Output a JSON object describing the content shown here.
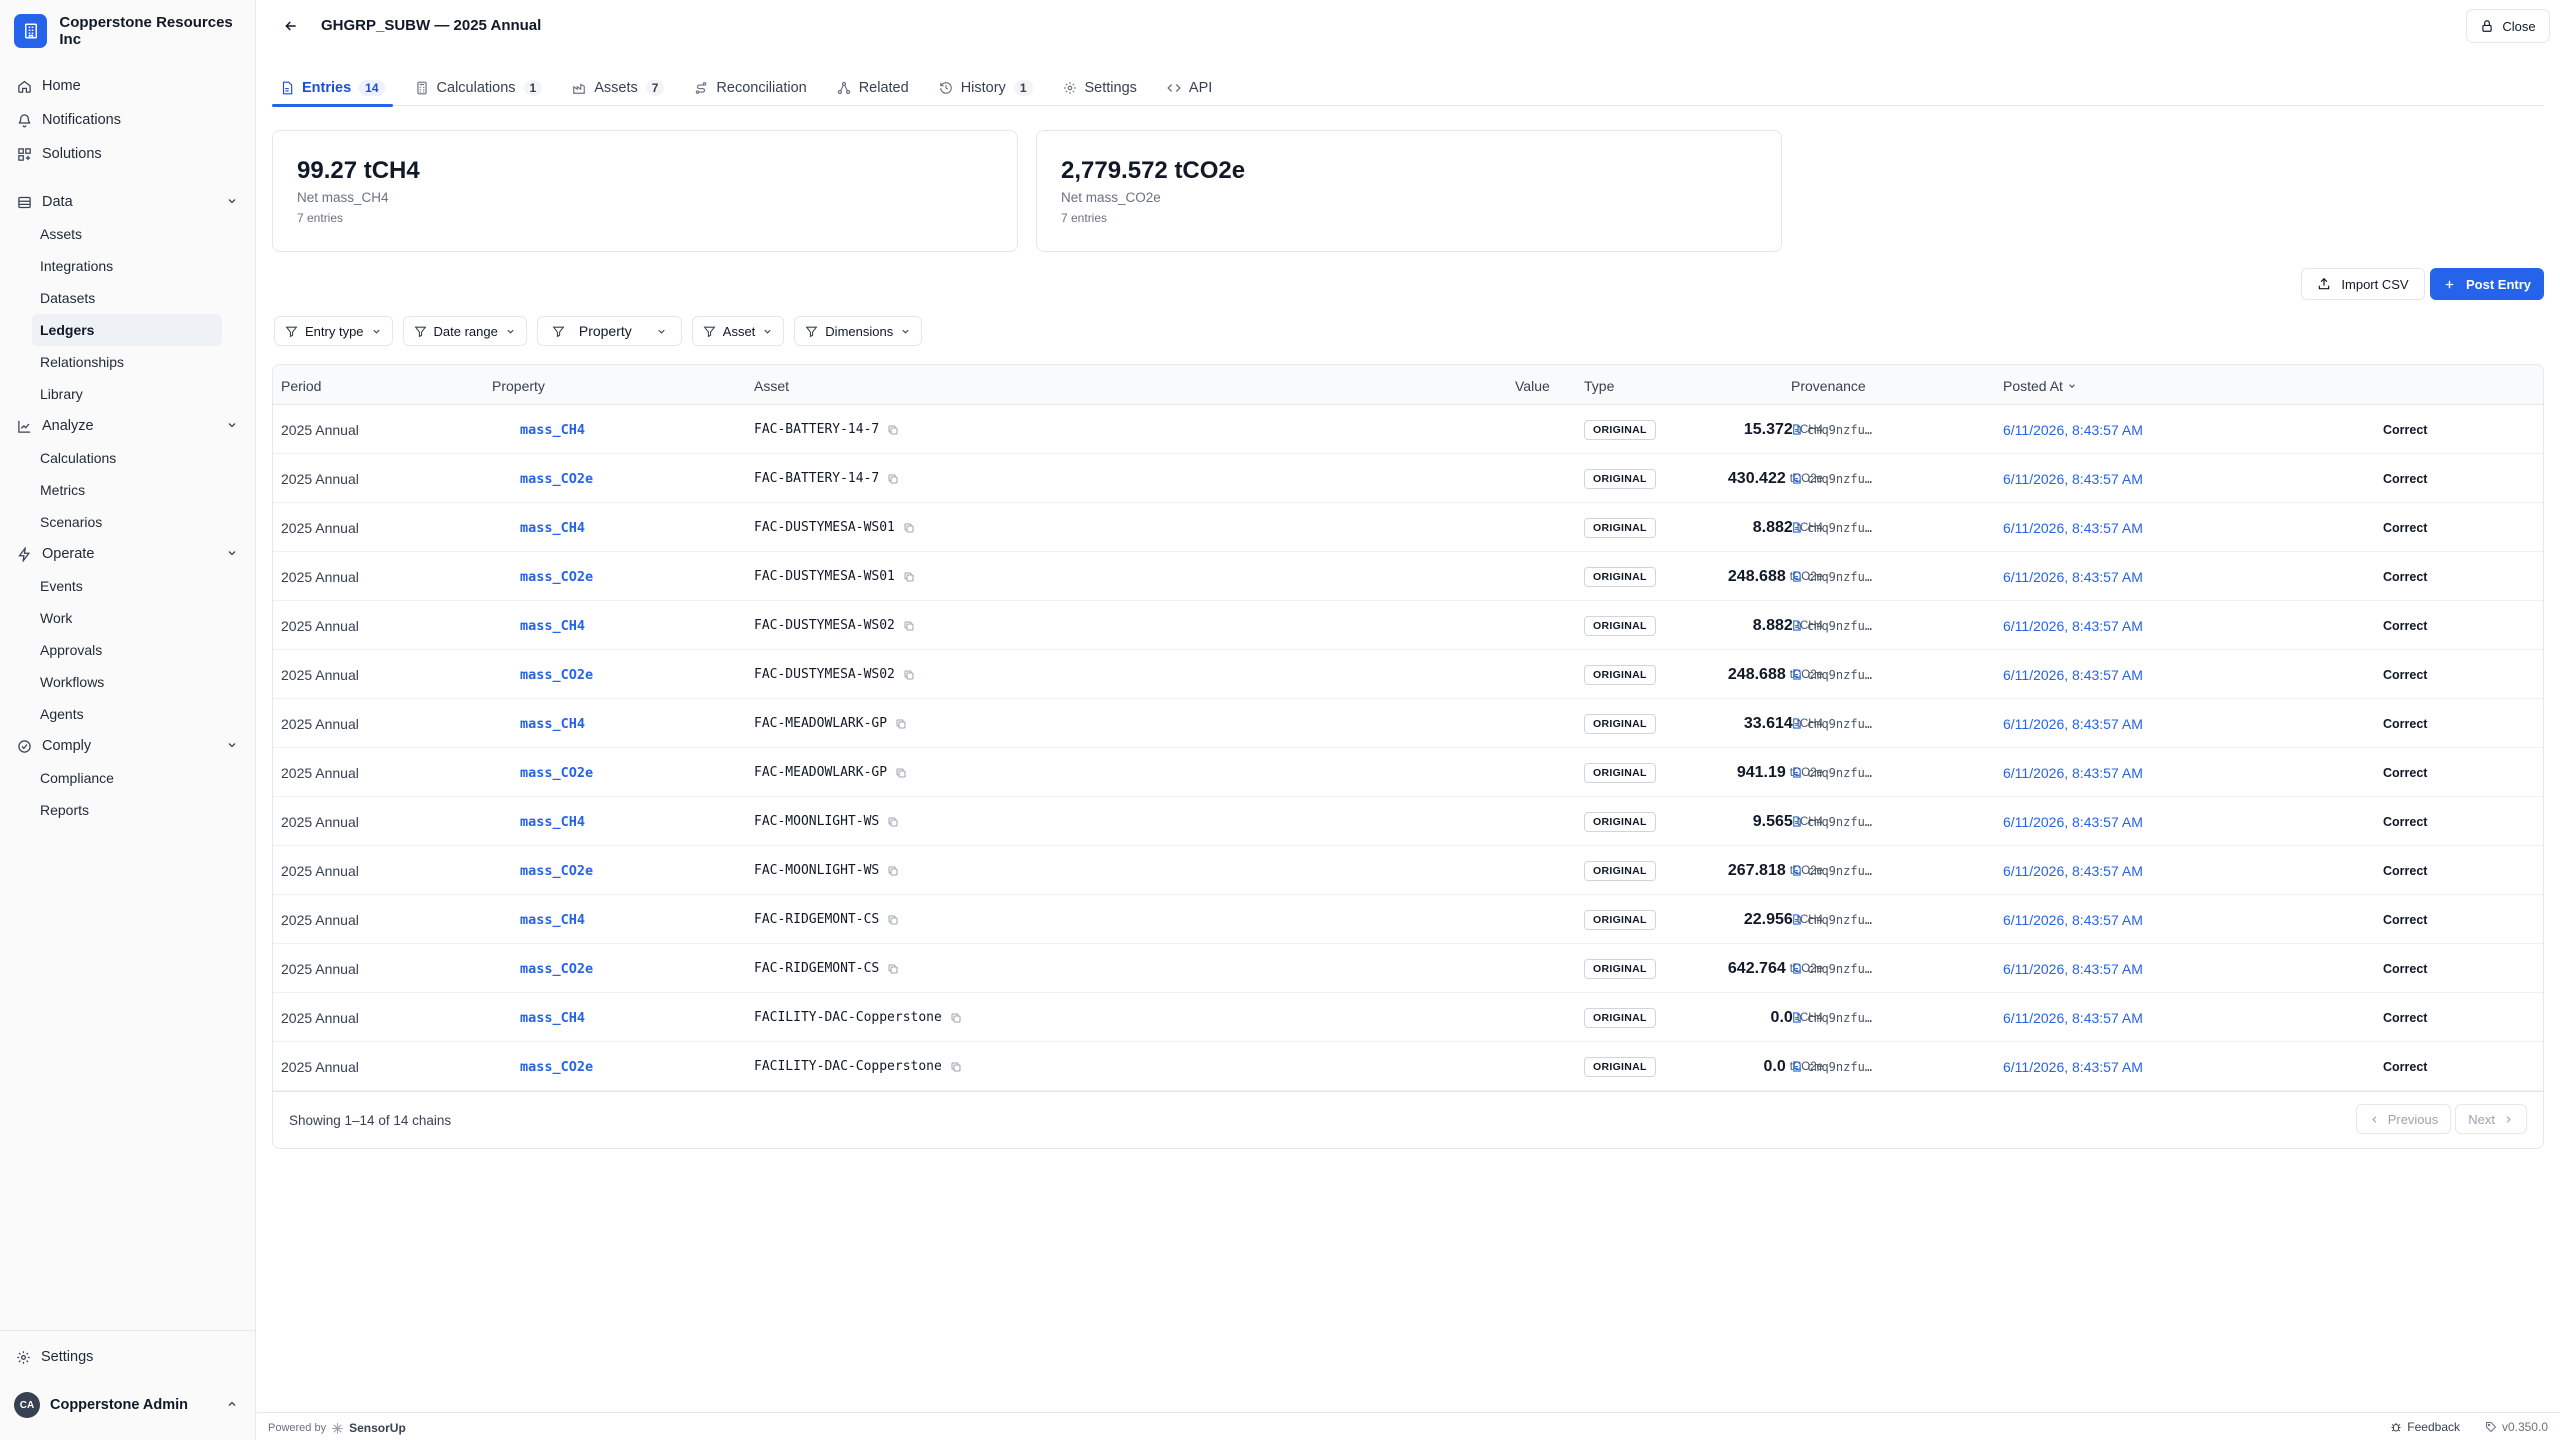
{
  "org": {
    "name": "Copperstone Resources Inc"
  },
  "nav": {
    "home": "Home",
    "notifications": "Notifications",
    "solutions": "Solutions",
    "data": {
      "label": "Data",
      "items": [
        "Assets",
        "Integrations",
        "Datasets",
        "Ledgers",
        "Relationships",
        "Library"
      ]
    },
    "analyze": {
      "label": "Analyze",
      "items": [
        "Calculations",
        "Metrics",
        "Scenarios"
      ]
    },
    "operate": {
      "label": "Operate",
      "items": [
        "Events",
        "Work",
        "Approvals",
        "Workflows",
        "Agents"
      ]
    },
    "comply": {
      "label": "Comply",
      "items": [
        "Compliance",
        "Reports"
      ]
    },
    "settings": "Settings",
    "user": {
      "initials": "CA",
      "name": "Copperstone Admin"
    }
  },
  "header": {
    "title": "GHGRP_SUBW — 2025 Annual",
    "close_label": "Close"
  },
  "tabs": [
    {
      "label": "Entries",
      "count": "14"
    },
    {
      "label": "Calculations",
      "count": "1"
    },
    {
      "label": "Assets",
      "count": "7"
    },
    {
      "label": "Reconciliation"
    },
    {
      "label": "Related"
    },
    {
      "label": "History",
      "count": "1"
    },
    {
      "label": "Settings"
    },
    {
      "label": "API"
    }
  ],
  "cards": [
    {
      "value": "99.27 tCH4",
      "label": "Net mass_CH4",
      "entries": "7 entries"
    },
    {
      "value": "2,779.572 tCO2e",
      "label": "Net mass_CO2e",
      "entries": "7 entries"
    }
  ],
  "actions": {
    "import": "Import CSV",
    "post": "Post Entry"
  },
  "filters": [
    "Entry type",
    "Date range",
    "Property",
    "Asset",
    "Dimensions"
  ],
  "table": {
    "columns": [
      "Period",
      "Property",
      "Asset",
      "Value",
      "Type",
      "Provenance",
      "Posted At"
    ],
    "rows": [
      {
        "period": "2025 Annual",
        "property": "mass_CH4",
        "asset": "FAC-BATTERY-14-7",
        "value": "15.372",
        "unit": "tCH4",
        "type": "ORIGINAL",
        "provenance": "cmq9nzfu…",
        "posted": "6/11/2026, 8:43:57 AM",
        "action": "Correct"
      },
      {
        "period": "2025 Annual",
        "property": "mass_CO2e",
        "asset": "FAC-BATTERY-14-7",
        "value": "430.422",
        "unit": "tCO2e",
        "type": "ORIGINAL",
        "provenance": "cmq9nzfu…",
        "posted": "6/11/2026, 8:43:57 AM",
        "action": "Correct"
      },
      {
        "period": "2025 Annual",
        "property": "mass_CH4",
        "asset": "FAC-DUSTYMESA-WS01",
        "value": "8.882",
        "unit": "tCH4",
        "type": "ORIGINAL",
        "provenance": "cmq9nzfu…",
        "posted": "6/11/2026, 8:43:57 AM",
        "action": "Correct"
      },
      {
        "period": "2025 Annual",
        "property": "mass_CO2e",
        "asset": "FAC-DUSTYMESA-WS01",
        "value": "248.688",
        "unit": "tCO2e",
        "type": "ORIGINAL",
        "provenance": "cmq9nzfu…",
        "posted": "6/11/2026, 8:43:57 AM",
        "action": "Correct"
      },
      {
        "period": "2025 Annual",
        "property": "mass_CH4",
        "asset": "FAC-DUSTYMESA-WS02",
        "value": "8.882",
        "unit": "tCH4",
        "type": "ORIGINAL",
        "provenance": "cmq9nzfu…",
        "posted": "6/11/2026, 8:43:57 AM",
        "action": "Correct"
      },
      {
        "period": "2025 Annual",
        "property": "mass_CO2e",
        "asset": "FAC-DUSTYMESA-WS02",
        "value": "248.688",
        "unit": "tCO2e",
        "type": "ORIGINAL",
        "provenance": "cmq9nzfu…",
        "posted": "6/11/2026, 8:43:57 AM",
        "action": "Correct"
      },
      {
        "period": "2025 Annual",
        "property": "mass_CH4",
        "asset": "FAC-MEADOWLARK-GP",
        "value": "33.614",
        "unit": "tCH4",
        "type": "ORIGINAL",
        "provenance": "cmq9nzfu…",
        "posted": "6/11/2026, 8:43:57 AM",
        "action": "Correct"
      },
      {
        "period": "2025 Annual",
        "property": "mass_CO2e",
        "asset": "FAC-MEADOWLARK-GP",
        "value": "941.19",
        "unit": "tCO2e",
        "type": "ORIGINAL",
        "provenance": "cmq9nzfu…",
        "posted": "6/11/2026, 8:43:57 AM",
        "action": "Correct"
      },
      {
        "period": "2025 Annual",
        "property": "mass_CH4",
        "asset": "FAC-MOONLIGHT-WS",
        "value": "9.565",
        "unit": "tCH4",
        "type": "ORIGINAL",
        "provenance": "cmq9nzfu…",
        "posted": "6/11/2026, 8:43:57 AM",
        "action": "Correct"
      },
      {
        "period": "2025 Annual",
        "property": "mass_CO2e",
        "asset": "FAC-MOONLIGHT-WS",
        "value": "267.818",
        "unit": "tCO2e",
        "type": "ORIGINAL",
        "provenance": "cmq9nzfu…",
        "posted": "6/11/2026, 8:43:57 AM",
        "action": "Correct"
      },
      {
        "period": "2025 Annual",
        "property": "mass_CH4",
        "asset": "FAC-RIDGEMONT-CS",
        "value": "22.956",
        "unit": "tCH4",
        "type": "ORIGINAL",
        "provenance": "cmq9nzfu…",
        "posted": "6/11/2026, 8:43:57 AM",
        "action": "Correct"
      },
      {
        "period": "2025 Annual",
        "property": "mass_CO2e",
        "asset": "FAC-RIDGEMONT-CS",
        "value": "642.764",
        "unit": "tCO2e",
        "type": "ORIGINAL",
        "provenance": "cmq9nzfu…",
        "posted": "6/11/2026, 8:43:57 AM",
        "action": "Correct"
      },
      {
        "period": "2025 Annual",
        "property": "mass_CH4",
        "asset": "FACILITY-DAC-Copperstone",
        "value": "0.0",
        "unit": "tCH4",
        "type": "ORIGINAL",
        "provenance": "cmq9nzfu…",
        "posted": "6/11/2026, 8:43:57 AM",
        "action": "Correct"
      },
      {
        "period": "2025 Annual",
        "property": "mass_CO2e",
        "asset": "FACILITY-DAC-Copperstone",
        "value": "0.0",
        "unit": "tCO2e",
        "type": "ORIGINAL",
        "provenance": "cmq9nzfu…",
        "posted": "6/11/2026, 8:43:57 AM",
        "action": "Correct"
      }
    ],
    "showing": "Showing 1–14 of 14 chains",
    "prev": "Previous",
    "next": "Next"
  },
  "footer": {
    "powered_by": "Powered by",
    "brand": "SensorUp",
    "feedback": "Feedback",
    "version": "v0.350.0"
  },
  "colors": {
    "accent": "#2563eb",
    "sidebar_bg": "#fafafa",
    "border": "#e5e7eb"
  }
}
